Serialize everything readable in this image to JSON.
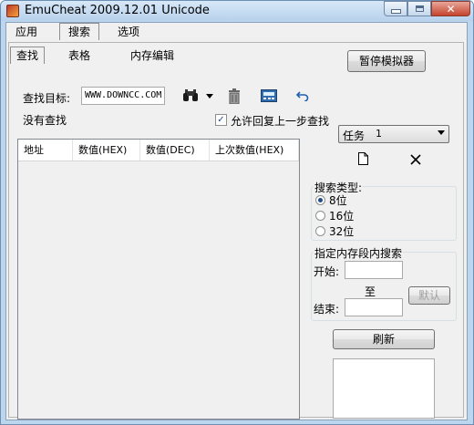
{
  "window": {
    "title": "EmuCheat 2009.12.01 Unicode"
  },
  "tabs": [
    "应用",
    "搜索",
    "选项"
  ],
  "subtabs": [
    "查找",
    "表格",
    "内存编辑"
  ],
  "pause_button": "暂停模拟器",
  "search": {
    "target_label": "查找目标:",
    "target_value": "WWW.DOWNCC.COM",
    "status": "没有查找",
    "allow_checkbox_label": "允许回复上一步查找",
    "allow_checked": true
  },
  "task": {
    "label": "任务",
    "value": "1"
  },
  "list_columns": [
    "地址",
    "数值(HEX)",
    "数值(DEC)",
    "上次数值(HEX)"
  ],
  "search_type": {
    "title": "搜索类型:",
    "options": [
      "8位",
      "16位",
      "32位"
    ],
    "selected_index": 0
  },
  "range": {
    "title": "指定内存段内搜索",
    "start_label": "开始:",
    "to_label": "至",
    "end_label": "结束:",
    "default_button": "默认"
  },
  "refresh_button": "刷新",
  "check_mark": "✓"
}
